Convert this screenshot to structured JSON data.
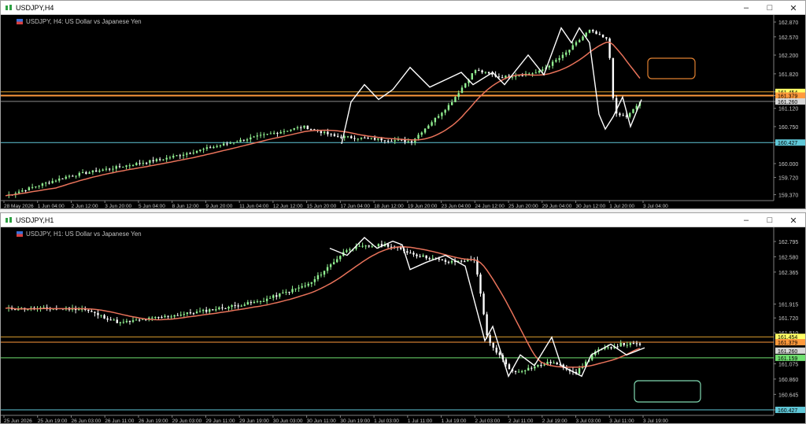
{
  "colors": {
    "bg": "#000000",
    "bull": "#90ee90",
    "bear": "#ffffff",
    "ma": "#e8725a",
    "zigzag": "#ffffff",
    "orange_line": "#e0a030",
    "cyan_line": "#60c8d8",
    "orange_box": "#e08030",
    "green_box": "#80d8b0",
    "yellow_tag": "#ffff66",
    "orange_tag": "#ff9a3c",
    "green_tag": "#70e070",
    "cyan_tag": "#60c8d8",
    "grid_text": "#c8c8c8"
  },
  "top_window": {
    "title": "USDJPY,H4",
    "header": "USDJPY, H4: US Dollar vs Japanese Yen",
    "controls": [
      "minimize-icon",
      "maximize-icon",
      "close-icon"
    ],
    "price_ticks": [
      "162.870",
      "162.570",
      "162.200",
      "161.820",
      "161.454",
      "161.379",
      "161.260",
      "161.120",
      "160.750",
      "160.427",
      "160.000",
      "159.720",
      "159.370"
    ],
    "time_ticks": [
      "28 May 2026",
      "1 Jun 04:00",
      "2 Jun 12:00",
      "3 Jun 20:00",
      "5 Jun 04:00",
      "8 Jun 12:00",
      "9 Jun 20:00",
      "11 Jun 04:00",
      "12 Jun 12:00",
      "15 Jun 20:00",
      "17 Jun 04:00",
      "18 Jun 12:00",
      "19 Jun 20:00",
      "23 Jun 04:00",
      "24 Jun 12:00",
      "25 Jun 20:00",
      "29 Jun 04:00",
      "30 Jun 12:00",
      "1 Jul 20:00",
      "3 Jul 04:00"
    ],
    "price_tags": {
      "yellow": "161.454",
      "orange": "161.379",
      "white": "161.260",
      "cyan": "160.427"
    },
    "price_range": [
      159.25,
      162.95
    ]
  },
  "bottom_window": {
    "title": "USDJPY,H1",
    "header": "USDJPY, H1: US Dollar vs Japanese Yen",
    "controls": [
      "minimize-icon",
      "maximize-icon",
      "close-icon"
    ],
    "price_ticks": [
      "162.795",
      "162.580",
      "162.365",
      "161.915",
      "161.720",
      "161.510",
      "161.075",
      "160.860",
      "160.645",
      "160.427"
    ],
    "time_ticks": [
      "25 Jun 2026",
      "25 Jun 19:00",
      "26 Jun 03:00",
      "26 Jun 11:00",
      "26 Jun 19:00",
      "29 Jun 03:00",
      "29 Jun 11:00",
      "29 Jun 19:00",
      "30 Jun 03:00",
      "30 Jun 11:00",
      "30 Jun 19:00",
      "1 Jul 03:00",
      "1 Jul 11:00",
      "1 Jul 19:00",
      "2 Jul 03:00",
      "2 Jul 11:00",
      "2 Jul 19:00",
      "3 Jul 03:00",
      "3 Jul 11:00",
      "3 Jul 19:00"
    ],
    "price_tags": {
      "yellow": "161.454",
      "orange": "161.379",
      "white": "161.260",
      "green": "161.159",
      "cyan": "160.427"
    },
    "price_range": [
      160.35,
      162.95
    ]
  }
}
